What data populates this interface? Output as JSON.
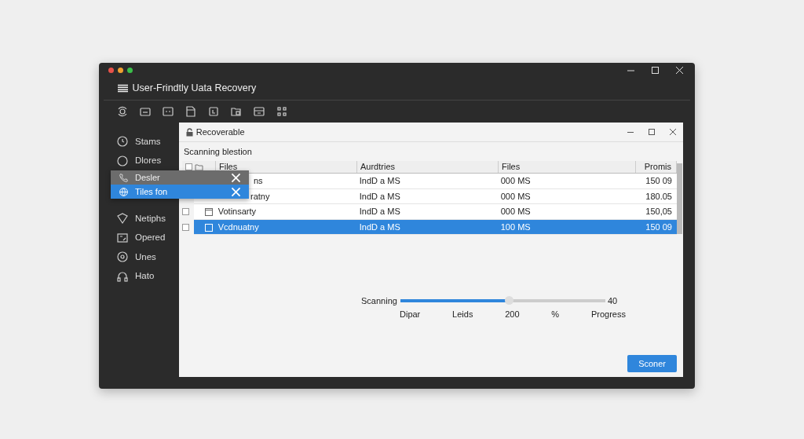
{
  "window": {
    "title": "User-Frindtly Uata Recovery"
  },
  "sidebar": {
    "items": [
      {
        "label": "Stams"
      },
      {
        "label": "Dlores"
      },
      {
        "label": "Netiphs"
      },
      {
        "label": "Opered"
      },
      {
        "label": "Unes"
      },
      {
        "label": "Hato"
      }
    ]
  },
  "popup": {
    "items": [
      {
        "label": "Desler",
        "selected": false
      },
      {
        "label": "Tiles fon",
        "selected": true
      }
    ]
  },
  "dialog": {
    "title": "Recoverable",
    "subtitle": "Scanning blestion",
    "table": {
      "all_checked": false,
      "columns": [
        "Files",
        "Aurdtries",
        "Files",
        "Promis"
      ],
      "rows": [
        {
          "cells": [
            "ns",
            "IndD a MS",
            "000 MS",
            "150 09"
          ],
          "covered": true,
          "selected": false
        },
        {
          "cells": [
            "ratny",
            "IndD a MS",
            "000 MS",
            "180.05"
          ],
          "covered": true,
          "selected": false
        },
        {
          "cells": [
            "Votinsarty",
            "IndD a MS",
            "000 MS",
            "150,05"
          ],
          "covered": false,
          "checked": false,
          "selected": false
        },
        {
          "cells": [
            "Vcdnuatny",
            "IndD a MS",
            "100 MS",
            "150 09"
          ],
          "covered": false,
          "checked": false,
          "selected": true
        }
      ]
    },
    "progress": {
      "label": "Scanning",
      "level": 0.53,
      "end_label": "40",
      "scale_labels": [
        "Dipar",
        "Leids",
        "200",
        "%",
        "Progress"
      ]
    },
    "button": "Sconer"
  }
}
